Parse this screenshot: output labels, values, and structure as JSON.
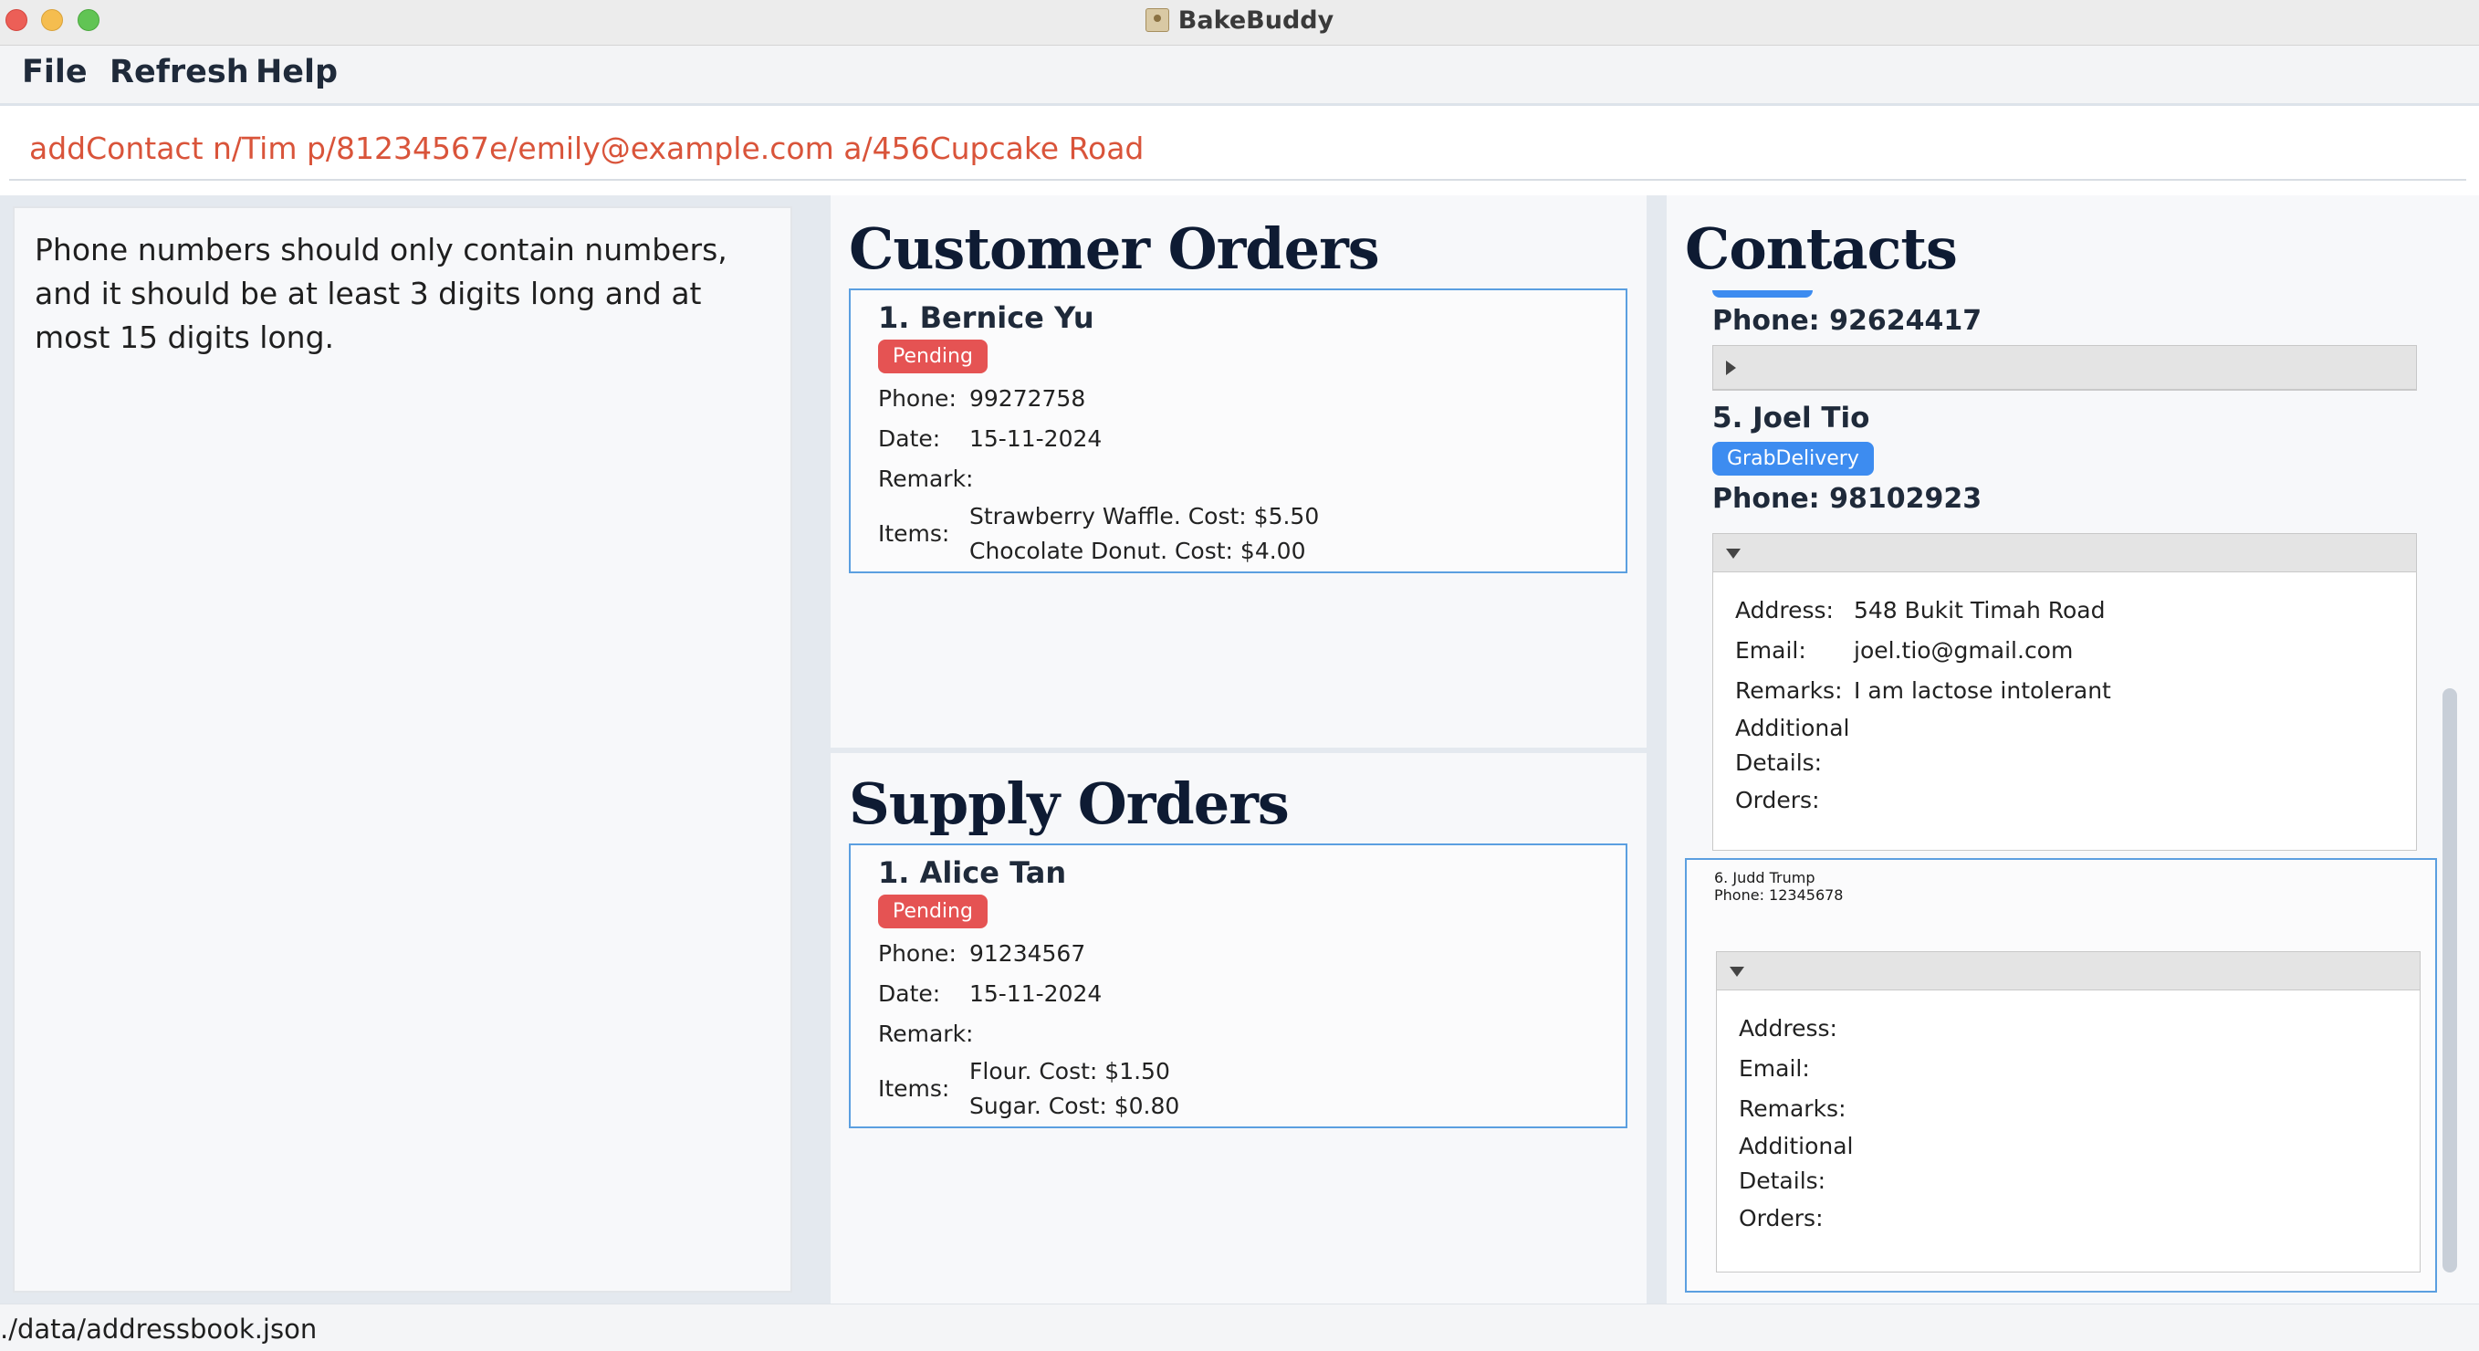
{
  "window": {
    "title": "BakeBuddy"
  },
  "menu": {
    "file": "File",
    "refresh": "Refresh",
    "help": "Help"
  },
  "command": {
    "value": "addContact n/Tim p/81234567e/emily@example.com a/456Cupcake Road"
  },
  "result": {
    "message": "Phone numbers should only contain numbers, and it should be at least 3 digits long and at most 15 digits long."
  },
  "customer_orders": {
    "title": "Customer Orders",
    "labels": {
      "phone": "Phone:",
      "date": "Date:",
      "remark": "Remark:",
      "items": "Items:"
    },
    "items": [
      {
        "name": "1. Bernice Yu",
        "status": "Pending",
        "phone": "99272758",
        "date": "15-11-2024",
        "remark": "",
        "items": [
          "Strawberry Waffle. Cost: $5.50",
          "Chocolate Donut. Cost: $4.00"
        ]
      }
    ]
  },
  "supply_orders": {
    "title": "Supply Orders",
    "items": [
      {
        "name": "1. Alice Tan",
        "status": "Pending",
        "phone": "91234567",
        "date": "15-11-2024",
        "remark": "",
        "items": [
          "Flour. Cost: $1.50",
          "Sugar. Cost: $0.80"
        ]
      }
    ]
  },
  "contacts": {
    "title": "Contacts",
    "labels": {
      "address": "Address:",
      "email": "Email:",
      "remarks": "Remarks:",
      "additional": "Additional",
      "details": "Details:",
      "orders": "Orders:"
    },
    "partial": {
      "phone": "Phone: 92624417"
    },
    "joel": {
      "name": "5. Joel Tio",
      "tag": "GrabDelivery",
      "phone": "Phone: 98102923",
      "address": "548 Bukit Timah Road",
      "email": "joel.tio@gmail.com",
      "remarks": "I am lactose intolerant"
    },
    "judd": {
      "name": "6. Judd Trump",
      "phone": "Phone: 12345678"
    }
  },
  "status": {
    "path": "./data/addressbook.json"
  },
  "colors": {
    "accent": "#5b9fe0",
    "pending": "#e55353",
    "tag": "#3d8cf0",
    "command_text": "#d9543a"
  }
}
